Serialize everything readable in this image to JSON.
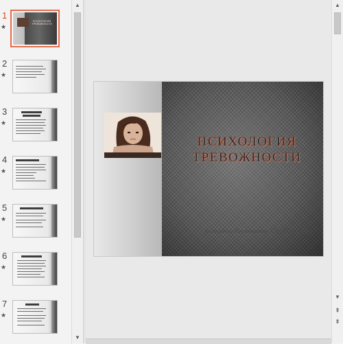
{
  "thumbnails": [
    {
      "number": "1",
      "star": "★",
      "title": "ПСИХОЛОГИЯ ТРЕВОЖНОСТИ"
    },
    {
      "number": "2",
      "star": "★"
    },
    {
      "number": "3",
      "star": "★"
    },
    {
      "number": "4",
      "star": "★"
    },
    {
      "number": "5",
      "star": "★"
    },
    {
      "number": "6",
      "star": "★"
    },
    {
      "number": "7",
      "star": "★"
    }
  ],
  "slide": {
    "title": "ПСИХОЛОГИЯ ТРЕВОЖНОСТИ",
    "subtitle": "Выполнила: Стальмакович А.Н.505 гр., заочн"
  },
  "scrollbar": {
    "up_arrow": "▲",
    "down_arrow": "▼",
    "prev_slide": "⇞",
    "next_slide": "⇟"
  },
  "colors": {
    "accent": "#d24726",
    "selection_outline": "#e46c4c",
    "title_glow": "#d9826a"
  }
}
